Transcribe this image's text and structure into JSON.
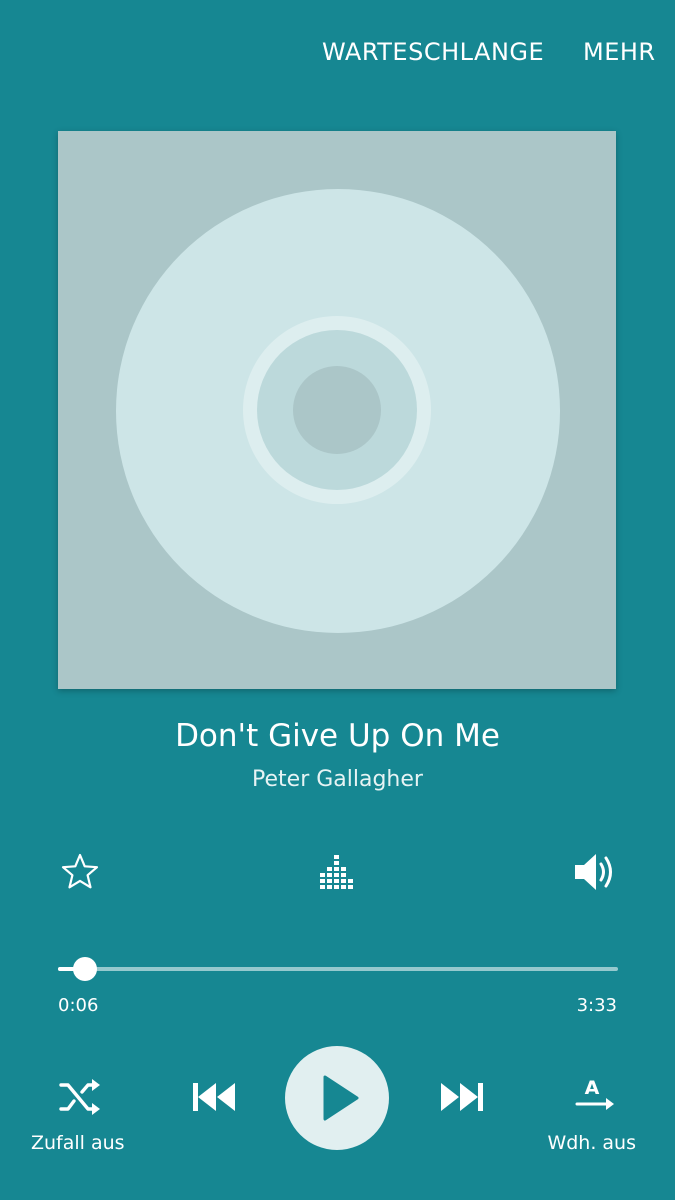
{
  "header": {
    "queue_label": "WARTESCHLANGE",
    "more_label": "MEHR"
  },
  "album_art": {
    "icon": "cd-disc-placeholder",
    "background_color": "#abc6c8",
    "disc_color": "#cde5e7"
  },
  "track": {
    "title": "Don't Give Up On Me",
    "artist": "Peter Gallagher"
  },
  "actions": {
    "favorite_icon": "star-outline-icon",
    "equalizer_icon": "equalizer-icon",
    "volume_icon": "volume-icon"
  },
  "progress": {
    "elapsed": "0:06",
    "total": "3:33",
    "fraction": 0.028
  },
  "controls": {
    "shuffle_label": "Zufall aus",
    "repeat_label": "Wdh. aus",
    "shuffle_icon": "shuffle-icon",
    "prev_icon": "skip-previous-icon",
    "play_icon": "play-icon",
    "next_icon": "skip-next-icon",
    "repeat_icon": "repeat-off-icon"
  },
  "colors": {
    "background": "#168792",
    "play_button": "#e1eff0",
    "play_glyph": "#168792"
  }
}
